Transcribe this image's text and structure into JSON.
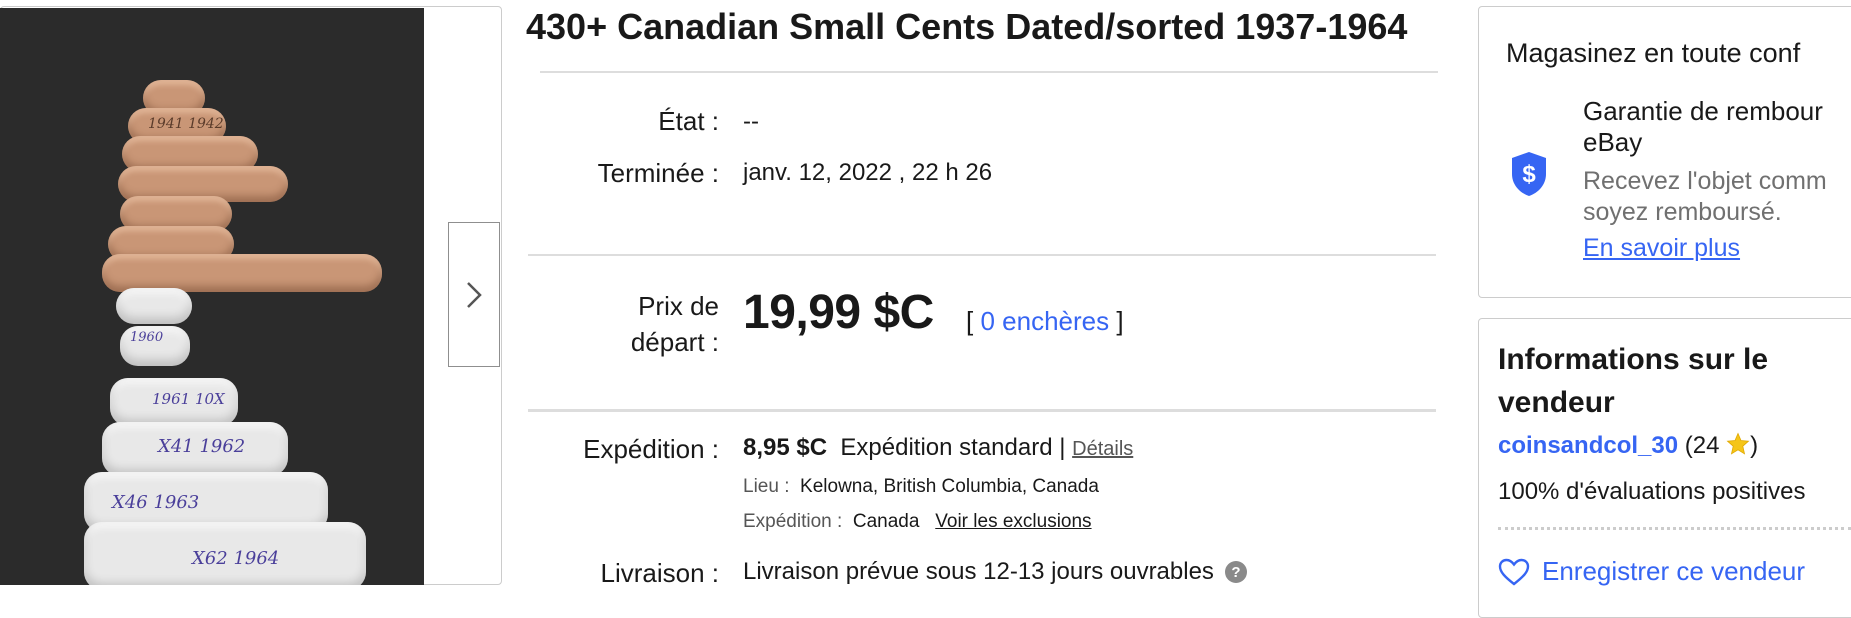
{
  "listing": {
    "title": "430+ Canadian Small Cents Dated/sorted 1937-1964"
  },
  "gallery": {
    "next_icon": "chevron-right-icon",
    "roll_labels": [
      "1941 1942",
      "1960",
      "1961 10X",
      "X41 1962",
      "X46 1963",
      "X62 1964"
    ]
  },
  "details": {
    "condition_label": "État :",
    "condition_value": "--",
    "ended_label": "Terminée :",
    "ended_value": "janv. 12, 2022 , 22 h 26",
    "price_label_line1": "Prix de",
    "price_label_line2": "départ :",
    "price_value": "19,99 $C",
    "bids_open": "[",
    "bids_link": "0 enchères",
    "bids_close": "]",
    "shipping_label": "Expédition :",
    "shipping_cost": "8,95 $C",
    "shipping_method": "Expédition standard |",
    "shipping_details_link": "Détails",
    "location_label": "Lieu :",
    "location_value": "Kelowna, British Columbia, Canada",
    "ships_to_label": "Expédition :",
    "ships_to_value": "Canada",
    "exclusions_link": "Voir les exclusions",
    "delivery_label": "Livraison :",
    "delivery_value": "Livraison prévue sous 12-13 jours ouvrables",
    "help_icon": "question-icon"
  },
  "trust_panel": {
    "title": "Magasinez en toute conf",
    "guarantee_line1": "Garantie de rembour",
    "guarantee_line2": "eBay",
    "desc_line1": "Recevez l'objet comm",
    "desc_line2": "soyez remboursé.",
    "learn_more": "En savoir plus",
    "shield_icon": "dollar-shield-icon"
  },
  "seller_panel": {
    "title": "Informations sur le vendeur",
    "seller_name": "coinsandcol_30",
    "feedback_open": " (24 ",
    "feedback_close": ")",
    "star_icon": "star-icon",
    "positive": "100% d'évaluations positives",
    "save_label": "Enregistrer ce vendeur",
    "heart_icon": "heart-icon"
  },
  "colors": {
    "link_blue": "#3665f3",
    "text": "#191919",
    "muted": "#555555",
    "border": "#cccccc",
    "shield_blue": "#3665f3",
    "star_yellow": "#f5c518"
  }
}
